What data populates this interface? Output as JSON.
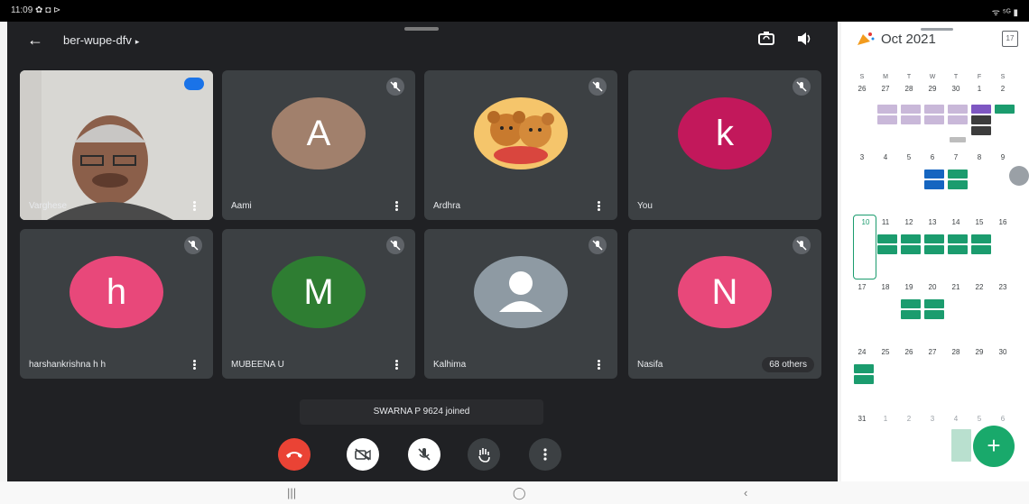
{
  "status_bar": {
    "time": "11:09 ✿ ◘ ⊳",
    "right": "ᯤ ⁵ᴳ ▮"
  },
  "meeting": {
    "code": "ber-wupe-dfv",
    "caret": "▸",
    "back_icon": "arrow-left-icon",
    "switch_camera_icon": "camera-switch-icon",
    "speaker_icon": "speaker-icon"
  },
  "participants": [
    {
      "name": "Varghese",
      "type": "video",
      "muted": false,
      "speaking": true
    },
    {
      "name": "Aami",
      "initial": "A",
      "color": "#a1806c",
      "muted": true
    },
    {
      "name": "Ardhra",
      "type": "image",
      "muted": true
    },
    {
      "name": "You",
      "initial": "k",
      "color": "#c2185b",
      "muted": true
    },
    {
      "name": "harshankrishna h h",
      "initial": "h",
      "color": "#e8487a",
      "muted": true
    },
    {
      "name": "MUBEENA U",
      "initial": "M",
      "color": "#2e7d32",
      "muted": true
    },
    {
      "name": "Kalhima",
      "type": "default",
      "muted": true
    },
    {
      "name": "Nasifa",
      "initial": "N",
      "color": "#e8487a",
      "muted": true,
      "others": "68 others"
    }
  ],
  "toast": "SWARNA P 9624 joined",
  "controls": {
    "end_call": "end-call-icon",
    "camera": "camera-off-icon",
    "mic": "mic-off-icon",
    "raise_hand": "raise-hand-icon",
    "more": "more-options-icon"
  },
  "calendar": {
    "month": "Oct 2021",
    "emoji_icon": "party-emoji-icon",
    "today_icon": "calendar-today-icon",
    "today_label": "17",
    "weekdays": [
      "S",
      "M",
      "T",
      "W",
      "T",
      "F",
      "S"
    ],
    "weeks": [
      [
        "26",
        "27",
        "28",
        "29",
        "30",
        "1",
        "2"
      ],
      [
        "3",
        "4",
        "5",
        "6",
        "7",
        "8",
        "9"
      ],
      [
        "10",
        "11",
        "12",
        "13",
        "14",
        "15",
        "16"
      ],
      [
        "17",
        "18",
        "19",
        "20",
        "21",
        "22",
        "23"
      ],
      [
        "24",
        "25",
        "26",
        "27",
        "28",
        "29",
        "30"
      ],
      [
        "31",
        "1",
        "2",
        "3",
        "4",
        "5",
        "6"
      ]
    ],
    "fab_icon": "plus-icon",
    "fab_label": "+"
  },
  "navbar": {
    "recents": "|||",
    "home": "◯",
    "back": "‹"
  },
  "colors": {
    "meet_bg": "#202124",
    "tile_bg": "#3c4043",
    "end_call": "#ea4335",
    "accent_green": "#19a96b"
  }
}
